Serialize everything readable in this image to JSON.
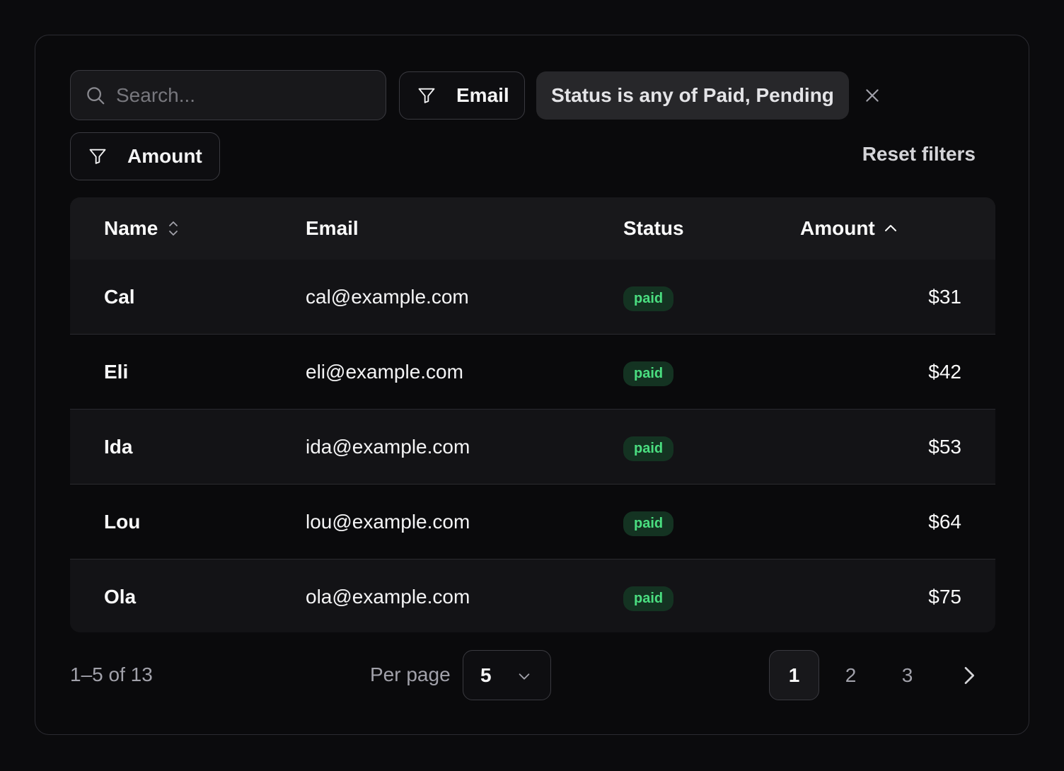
{
  "search": {
    "placeholder": "Search..."
  },
  "filters": {
    "email_label": "Email",
    "amount_label": "Amount",
    "status_chip": "Status is any of Paid, Pending",
    "reset_label": "Reset filters"
  },
  "table": {
    "columns": [
      "Name",
      "Email",
      "Status",
      "Amount"
    ],
    "rows": [
      {
        "name": "Cal",
        "email": "cal@example.com",
        "status": "paid",
        "amount": "$31"
      },
      {
        "name": "Eli",
        "email": "eli@example.com",
        "status": "paid",
        "amount": "$42"
      },
      {
        "name": "Ida",
        "email": "ida@example.com",
        "status": "paid",
        "amount": "$53"
      },
      {
        "name": "Lou",
        "email": "lou@example.com",
        "status": "paid",
        "amount": "$64"
      },
      {
        "name": "Ola",
        "email": "ola@example.com",
        "status": "paid",
        "amount": "$75"
      }
    ]
  },
  "pagination": {
    "range_text": "1–5 of 13",
    "per_page_label": "Per page",
    "per_page_value": "5",
    "pages": [
      "1",
      "2",
      "3"
    ],
    "active_page": "1"
  },
  "colors": {
    "background": "#0b0b0d",
    "paid_badge_bg": "#143322",
    "paid_badge_text": "#4ade80"
  },
  "icons": [
    "search-icon",
    "filter-icon",
    "close-icon",
    "sort-icon",
    "sort-asc-icon",
    "chevron-down-icon",
    "chevron-right-icon"
  ]
}
